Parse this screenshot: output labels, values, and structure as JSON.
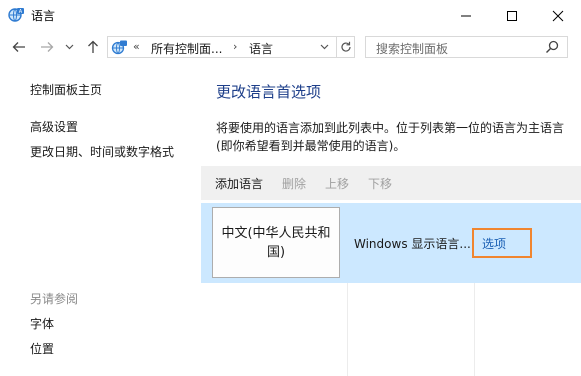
{
  "window": {
    "title": "语言",
    "controls": {
      "minimize": "—",
      "maximize": "☐",
      "close": "✕"
    }
  },
  "navbar": {
    "back_icon": "arrow-left-icon",
    "forward_icon": "arrow-right-icon",
    "recent_icon": "chevron-down-icon",
    "up_icon": "arrow-up-icon",
    "breadcrumb": {
      "overflow": "«",
      "items": [
        "所有控制面...",
        "语言"
      ],
      "separator": "›"
    },
    "search": {
      "placeholder": "搜索控制面板"
    }
  },
  "sidebar": {
    "home": "控制面板主页",
    "items": [
      "高级设置",
      "更改日期、时间或数字格式"
    ],
    "see_also": {
      "label": "另请参阅",
      "items": [
        "字体",
        "位置"
      ]
    }
  },
  "main": {
    "title": "更改语言首选项",
    "description": "将要使用的语言添加到此列表中。位于列表第一位的语言为主语言(即你希望看到并最常使用的语言)。",
    "toolbar": {
      "add": "添加语言",
      "remove": "删除",
      "move_up": "上移",
      "move_down": "下移"
    },
    "languages": [
      {
        "name": "中文(中华人民共和国)",
        "display": "Windows 显示语言...",
        "options": "选项"
      }
    ]
  },
  "colors": {
    "accent_title": "#1e3f8a",
    "selected_row": "#cce8ff",
    "highlight_border": "#f0852f",
    "link": "#1a5fb4"
  }
}
